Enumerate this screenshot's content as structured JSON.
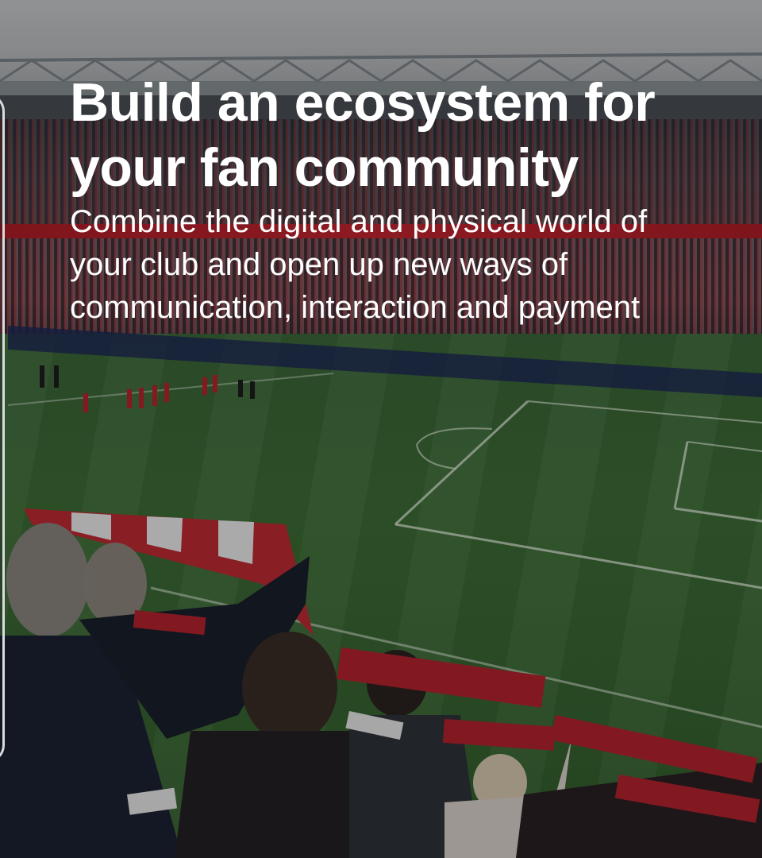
{
  "hero": {
    "headline": "Build an ecosystem for your fan community",
    "subheadline": "Combine the digital and physical world of your club and open up new ways of communication, interaction and payment"
  },
  "colors": {
    "text": "#ffffff",
    "accent_red": "#c42430",
    "pitch_green": "#3f7038"
  }
}
